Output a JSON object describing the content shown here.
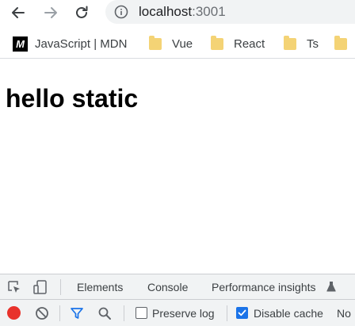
{
  "browser": {
    "url_host": "localhost",
    "url_port": ":3001",
    "icons": {
      "back": "arrow-left-icon",
      "forward": "arrow-right-icon",
      "reload": "reload-icon",
      "site_info": "info-icon"
    }
  },
  "bookmarks": [
    {
      "label": "JavaScript | MDN",
      "icon": "mdn-icon",
      "icon_text": "M"
    },
    {
      "label": "Vue",
      "icon": "folder-icon"
    },
    {
      "label": "React",
      "icon": "folder-icon"
    },
    {
      "label": "Ts",
      "icon": "folder-icon"
    },
    {
      "label": "",
      "icon": "folder-icon"
    }
  ],
  "page": {
    "heading": "hello static"
  },
  "devtools": {
    "tabs": [
      "Elements",
      "Console",
      "Performance insights"
    ],
    "toolbar": {
      "preserve_log_label": "Preserve log",
      "preserve_log_checked": false,
      "disable_cache_label": "Disable cache",
      "disable_cache_checked": true,
      "throttle_label": "No"
    },
    "colors": {
      "record": "#e8322b",
      "accent": "#1a73e8",
      "panel_bg": "#f1f3f4"
    }
  }
}
